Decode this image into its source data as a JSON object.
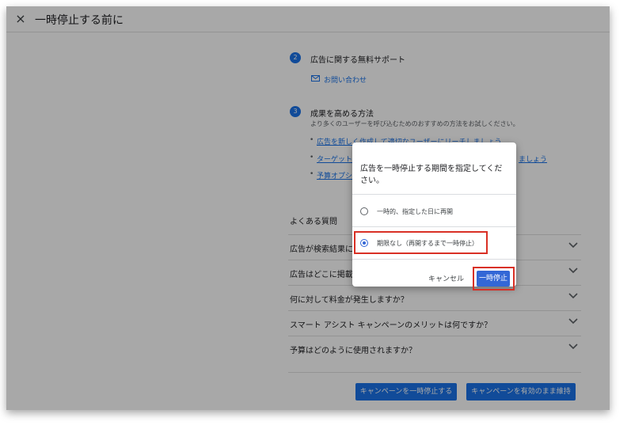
{
  "header": {
    "close_icon": "×",
    "title": "一時停止する前に"
  },
  "steps": [
    {
      "number": "2",
      "title": "広告に関する無料サポート",
      "contact_label": "お問い合わせ"
    },
    {
      "number": "3",
      "title": "成果を高める方法",
      "description": "より多くのユーザーを呼び込むためのおすすめの方法をお試しください。",
      "links": [
        "広告を新しく作成して適切なユーザーにリーチしましょう",
        "ターゲット",
        "ましょう",
        "予算オプシ"
      ]
    }
  ],
  "faq": {
    "heading": "よくある質問",
    "items": [
      "広告が検索結果に",
      "広告はどこに掲載",
      "何に対して料金が発生しますか？",
      "スマート アシスト キャンペーンのメリットは何ですか？",
      "予算はどのように使用されますか？"
    ]
  },
  "footer": {
    "pause_button": "キャンペーンを一時停止する",
    "keep_button": "キャンペーンを有効のまま維持"
  },
  "dialog": {
    "title": "広告を一時停止する期間を指定してください。",
    "options": [
      {
        "label": "一時的、指定した日に再開",
        "selected": false
      },
      {
        "label": "期限なし（再開するまで一時停止）",
        "selected": true
      }
    ],
    "cancel_label": "キャンセル",
    "confirm_label": "一時停止"
  },
  "colors": {
    "primary": "#1a73e8",
    "dialog_button": "#3367d6",
    "highlight": "#d93025"
  }
}
